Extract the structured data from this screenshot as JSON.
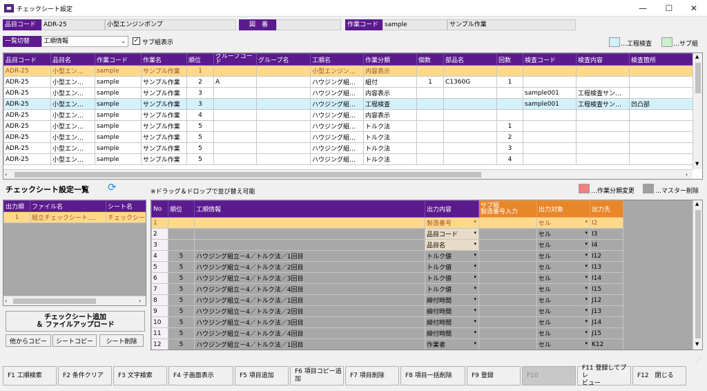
{
  "window": {
    "title": "チェックシート設定",
    "minimize": "—",
    "maximize": "☐",
    "close": "✕"
  },
  "header": {
    "hinmoku_label": "品目コード",
    "hinmoku_code": "ADR-25",
    "hinmoku_name": "小型エンジンポンプ",
    "zuban_label": "図　番",
    "zuban_value": "",
    "sagyo_label": "作業コード",
    "sagyo_code": "sample",
    "sagyo_name": "サンプル作業"
  },
  "list_switch": {
    "label": "一覧切替",
    "selected": "工順情報",
    "checkbox_label": "サブ組表示",
    "checked": "✓"
  },
  "legend_top": [
    {
      "label": "…工程検査",
      "color": "#d4f0fb"
    },
    {
      "label": "…サブ組",
      "color": "#ccf0cc"
    }
  ],
  "top_table": {
    "headers": [
      "品目コード",
      "品目名",
      "作業コード",
      "作業名",
      "順位",
      "グループコード",
      "グループ名",
      "工順名",
      "作業分類",
      "個数",
      "部品名",
      "回数",
      "検査コード",
      "検査内容",
      "検査箇所"
    ],
    "rows": [
      [
        "ADR-25",
        "小型エン…",
        "sample",
        "サンプル作業",
        "1",
        "",
        "",
        "小型エンジン…",
        "内容表示",
        "",
        "",
        "",
        "",
        "",
        ""
      ],
      [
        "ADR-25",
        "小型エン…",
        "sample",
        "サンプル作業",
        "2",
        "A",
        "",
        "ハウジング組…",
        "組付",
        "1",
        "C1360G",
        "1",
        "",
        "",
        ""
      ],
      [
        "ADR-25",
        "小型エン…",
        "sample",
        "サンプル作業",
        "3",
        "",
        "",
        "ハウジング組…",
        "内容表示",
        "",
        "",
        "",
        "sample001",
        "工程検査サン…",
        ""
      ],
      [
        "ADR-25",
        "小型エン…",
        "sample",
        "サンプル作業",
        "3",
        "",
        "",
        "ハウジング組…",
        "工程検査",
        "",
        "",
        "",
        "sample001",
        "工程検査サン…",
        "凹凸部"
      ],
      [
        "ADR-25",
        "小型エン…",
        "sample",
        "サンプル作業",
        "4",
        "",
        "",
        "ハウジング組…",
        "内容表示",
        "",
        "",
        "",
        "",
        "",
        ""
      ],
      [
        "ADR-25",
        "小型エン…",
        "sample",
        "サンプル作業",
        "5",
        "",
        "",
        "ハウジング組…",
        "トルク法",
        "",
        "",
        "1",
        "",
        "",
        ""
      ],
      [
        "ADR-25",
        "小型エン…",
        "sample",
        "サンプル作業",
        "5",
        "",
        "",
        "ハウジング組…",
        "トルク法",
        "",
        "",
        "2",
        "",
        "",
        ""
      ],
      [
        "ADR-25",
        "小型エン…",
        "sample",
        "サンプル作業",
        "5",
        "",
        "",
        "ハウジング組…",
        "トルク法",
        "",
        "",
        "3",
        "",
        "",
        ""
      ],
      [
        "ADR-25",
        "小型エン…",
        "sample",
        "サンプル作業",
        "5",
        "",
        "",
        "ハウジング組…",
        "トルク法",
        "",
        "",
        "4",
        "",
        "",
        ""
      ]
    ]
  },
  "section": {
    "title": "チェックシート設定一覧",
    "refresh_icon": "⟳",
    "note": "※ドラッグ＆ドロップで並び替え可能"
  },
  "legend_bottom": [
    {
      "label": "…作業分類変更",
      "color": "#f08080"
    },
    {
      "label": "…マスター削除",
      "color": "#a0a0a0"
    }
  ],
  "left_table": {
    "headers": [
      "出力順",
      "ファイル名",
      "シート名"
    ],
    "rows": [
      [
        "1",
        "組立チェックシート....",
        "チェックシー"
      ]
    ]
  },
  "left_buttons": {
    "add": "チェックシート追加\n＆ ファイルアップロード",
    "copy_other": "他からコピー",
    "sheet_copy": "シートコピー",
    "sheet_delete": "シート削除"
  },
  "main_table": {
    "headers": [
      "No",
      "順位",
      "工順情報",
      "出力内容",
      "サブ組\n製造番号入力",
      "出力対象",
      "出力先"
    ],
    "rows": [
      [
        "1",
        "",
        "",
        "製造番号",
        "",
        "セル",
        "I2"
      ],
      [
        "2",
        "",
        "",
        "品目コード",
        "",
        "セル",
        "I3"
      ],
      [
        "3",
        "",
        "",
        "品目名",
        "",
        "セル",
        "I4"
      ],
      [
        "4",
        "5",
        "ハウジング組立－4／トルク法／1回目",
        "トルク値",
        "",
        "セル",
        "I12"
      ],
      [
        "5",
        "5",
        "ハウジング組立－4／トルク法／2回目",
        "トルク値",
        "",
        "セル",
        "I13"
      ],
      [
        "6",
        "5",
        "ハウジング組立－4／トルク法／3回目",
        "トルク値",
        "",
        "セル",
        "I14"
      ],
      [
        "7",
        "5",
        "ハウジング組立－4／トルク法／4回目",
        "トルク値",
        "",
        "セル",
        "I15"
      ],
      [
        "8",
        "5",
        "ハウジング組立－4／トルク法／1回目",
        "締付時間",
        "",
        "セル",
        "J12"
      ],
      [
        "9",
        "5",
        "ハウジング組立－4／トルク法／2回目",
        "締付時間",
        "",
        "セル",
        "J13"
      ],
      [
        "10",
        "5",
        "ハウジング組立－4／トルク法／3回目",
        "締付時間",
        "",
        "セル",
        "J14"
      ],
      [
        "11",
        "5",
        "ハウジング組立－4／トルク法／4回目",
        "締付時間",
        "",
        "セル",
        "J15"
      ],
      [
        "12",
        "5",
        "ハウジング組立－4／トルク法／1回目",
        "作業者",
        "",
        "セル",
        "K12"
      ]
    ]
  },
  "fkeys": [
    "F1 工順検索",
    "F2 条件クリア",
    "F3 文字検索",
    "F4 子画面表示",
    "F5 項目追加",
    "F6 項目コピー追\n加",
    "F7 項目削除",
    "F8 項目一括削除",
    "F9 登録",
    "F10",
    "F11 登録してプレ\nビュー",
    "F12　閉じる"
  ]
}
